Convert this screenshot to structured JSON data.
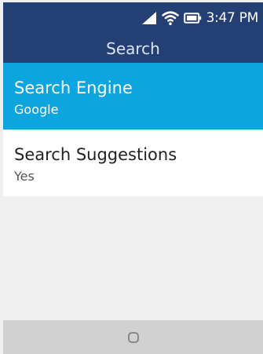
{
  "status_bar": {
    "time": "3:47 PM",
    "icons": [
      "signal-icon",
      "wifi-icon",
      "battery-icon"
    ]
  },
  "header": {
    "title": "Search"
  },
  "settings": {
    "items": [
      {
        "label": "Search Engine",
        "value": "Google",
        "selected": true
      },
      {
        "label": "Search Suggestions",
        "value": "Yes",
        "selected": false
      }
    ]
  },
  "softkeys": {
    "center_icon": "circle-select-icon"
  },
  "colors": {
    "header_background": "#233f73",
    "selected_background": "#0da5df",
    "softkey_background": "#d1d1d1",
    "page_background": "#efefef"
  }
}
